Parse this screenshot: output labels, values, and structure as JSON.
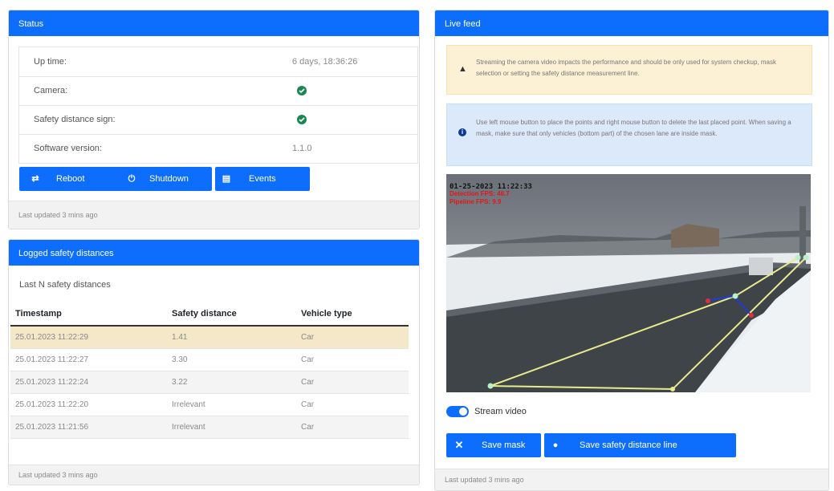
{
  "status": {
    "header": "Status",
    "rows": [
      {
        "label": "Up time:",
        "value": "6 days, 18:36:26"
      },
      {
        "label": "Camera:",
        "icon": "check-circle-icon"
      },
      {
        "label": "Safety distance sign:",
        "icon": "check-circle-icon"
      },
      {
        "label": "Software version:",
        "value": "1.1.0"
      }
    ],
    "buttons": {
      "reboot": "Reboot",
      "shutdown": "Shutdown",
      "events": "Events"
    },
    "footer": "Last updated 3 mins ago"
  },
  "logged": {
    "header": "Logged safety distances",
    "subtitle": "Last N safety distances",
    "columns": [
      "Timestamp",
      "Safety distance",
      "Vehicle type"
    ],
    "rows": [
      [
        "25.01.2023 11:22:29",
        "1.41",
        "Car"
      ],
      [
        "25.01.2023 11:22:27",
        "3.30",
        "Car"
      ],
      [
        "25.01.2023 11:22:24",
        "3.22",
        "Car"
      ],
      [
        "25.01.2023 11:22:20",
        "Irrelevant",
        "Car"
      ],
      [
        "25.01.2023 11:21:56",
        "Irrelevant",
        "Car"
      ]
    ],
    "footer": "Last updated 3 mins ago"
  },
  "feed": {
    "header": "Live feed",
    "warning": "Streaming the camera video impacts the performance and should be only used for system checkup, mask selection or setting the safety distance measurement line.",
    "info": "Use left mouse button to place the points and right mouse button to delete the last placed point. When saving a mask, make sure that only vehicles (bottom part) of the chosen lane are inside mask.",
    "overlay": {
      "timestamp": "01-25-2023 11:22:33",
      "detection": "Detection FPS: 46.7",
      "pipeline": "Pipeline FPS: 9.9"
    },
    "toggle_label": "Stream video",
    "toggle_on": true,
    "buttons": {
      "save_mask": "Save mask",
      "save_line": "Save safety distance line"
    },
    "footer": "Last updated 3 mins ago"
  },
  "colors": {
    "primary": "#0d6efd",
    "success": "#198754",
    "warning_bg": "#fcf1d4",
    "info_bg": "#dce9fb"
  }
}
